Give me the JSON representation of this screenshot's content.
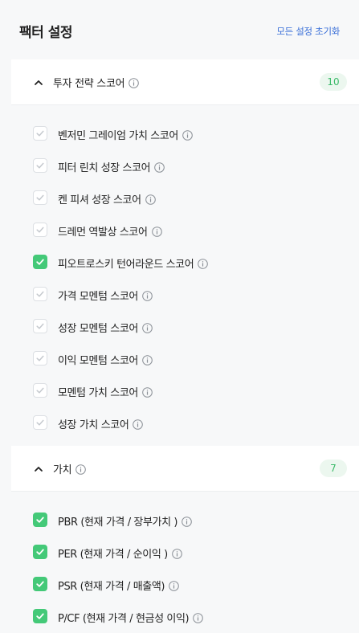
{
  "header": {
    "title": "팩터 설정",
    "reset_label": "모든 설정 초기화"
  },
  "sections": [
    {
      "title": "투자 전략 스코어",
      "count": "10",
      "expanded": true,
      "items": [
        {
          "label": "벤저민 그레이엄 가치 스코어",
          "checked": false
        },
        {
          "label": "피터 린치 성장 스코어",
          "checked": false
        },
        {
          "label": "켄 피셔 성장 스코어",
          "checked": false
        },
        {
          "label": "드레먼 역발상 스코어",
          "checked": false
        },
        {
          "label": "피오트로스키 턴어라운드 스코어",
          "checked": true
        },
        {
          "label": "가격 모멘텀 스코어",
          "checked": false
        },
        {
          "label": "성장 모멘텀 스코어",
          "checked": false
        },
        {
          "label": "이익 모멘텀 스코어",
          "checked": false
        },
        {
          "label": "모멘텀 가치 스코어",
          "checked": false
        },
        {
          "label": "성장 가치 스코어",
          "checked": false
        }
      ]
    },
    {
      "title": "가치",
      "count": "7",
      "expanded": true,
      "items": [
        {
          "label": "PBR (현재 가격 / 장부가치 )",
          "checked": true
        },
        {
          "label": "PER (현재 가격 / 순이익 )",
          "checked": true
        },
        {
          "label": "PSR (현재 가격 / 매출액)",
          "checked": true
        },
        {
          "label": "P/CF (현재 가격 / 현금성 이익)",
          "checked": true
        }
      ]
    }
  ],
  "colors": {
    "accent_green": "#44c978",
    "badge_text": "#3dbb6a",
    "badge_bg": "#ecf7ef",
    "link_blue": "#3a6fd8"
  },
  "icons": {
    "chevron": "chevron-up-icon",
    "info": "info-circle-icon",
    "check": "check-icon"
  }
}
